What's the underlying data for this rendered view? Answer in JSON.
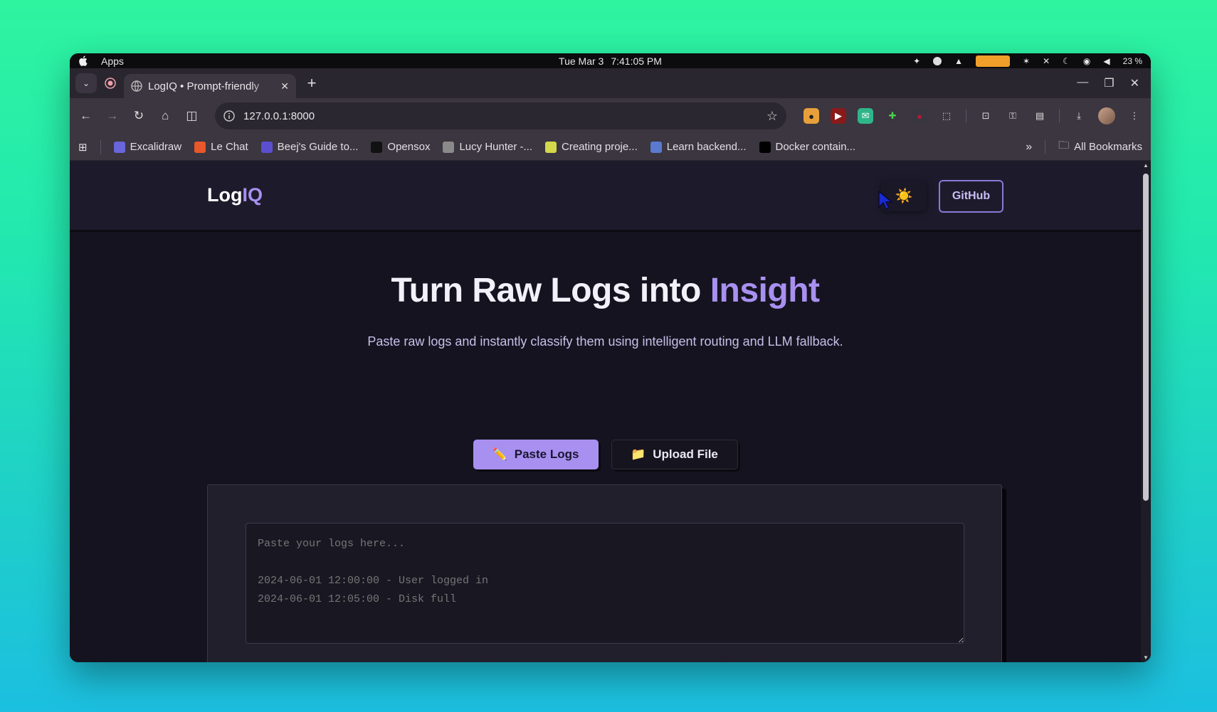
{
  "menubar": {
    "app_label": "Apps",
    "date": "Tue Mar 3",
    "time": "7:41:05 PM",
    "battery": "23 %"
  },
  "tabs": [
    {
      "title": "LogIQ • Prompt-friendly"
    }
  ],
  "address_bar": {
    "url": "127.0.0.1:8000"
  },
  "bookmarks": [
    {
      "label": "Excalidraw",
      "icon": "excalidraw-icon",
      "color": "#6965db"
    },
    {
      "label": "Le Chat",
      "icon": "mistral-icon",
      "color": "#e8582a"
    },
    {
      "label": "Beej's Guide to...",
      "icon": "beej-icon",
      "color": "#5b4fcf"
    },
    {
      "label": "Opensox",
      "icon": "opensox-icon",
      "color": "#111111"
    },
    {
      "label": "Lucy Hunter -...",
      "icon": "lucy-icon",
      "color": "#8a8a8a"
    },
    {
      "label": "Creating proje...",
      "icon": "project-icon",
      "color": "#d4d84a"
    },
    {
      "label": "Learn backend...",
      "icon": "backend-icon",
      "color": "#5a7ad0"
    },
    {
      "label": "Docker contain...",
      "icon": "medium-icon",
      "color": "#000000"
    }
  ],
  "bookmarks_folder": "All Bookmarks",
  "site": {
    "logo_main": "Log",
    "logo_accent": "IQ",
    "theme_icon": "☀️",
    "github_label": "GitHub",
    "hero_title_main": "Turn Raw Logs into ",
    "hero_title_accent": "Insight",
    "hero_subtitle": "Paste raw logs and instantly classify them using intelligent routing and LLM fallback.",
    "paste_button": {
      "icon": "✏️",
      "label": "Paste Logs"
    },
    "upload_button": {
      "icon": "📁",
      "label": "Upload File"
    },
    "log_input_placeholder": "Paste your logs here...\n\n2024-06-01 12:00:00 - User logged in\n2024-06-01 12:05:00 - Disk full"
  },
  "colors": {
    "accent": "#a890f0",
    "page_bg": "#151320",
    "header_bg": "#1d1b2b"
  }
}
